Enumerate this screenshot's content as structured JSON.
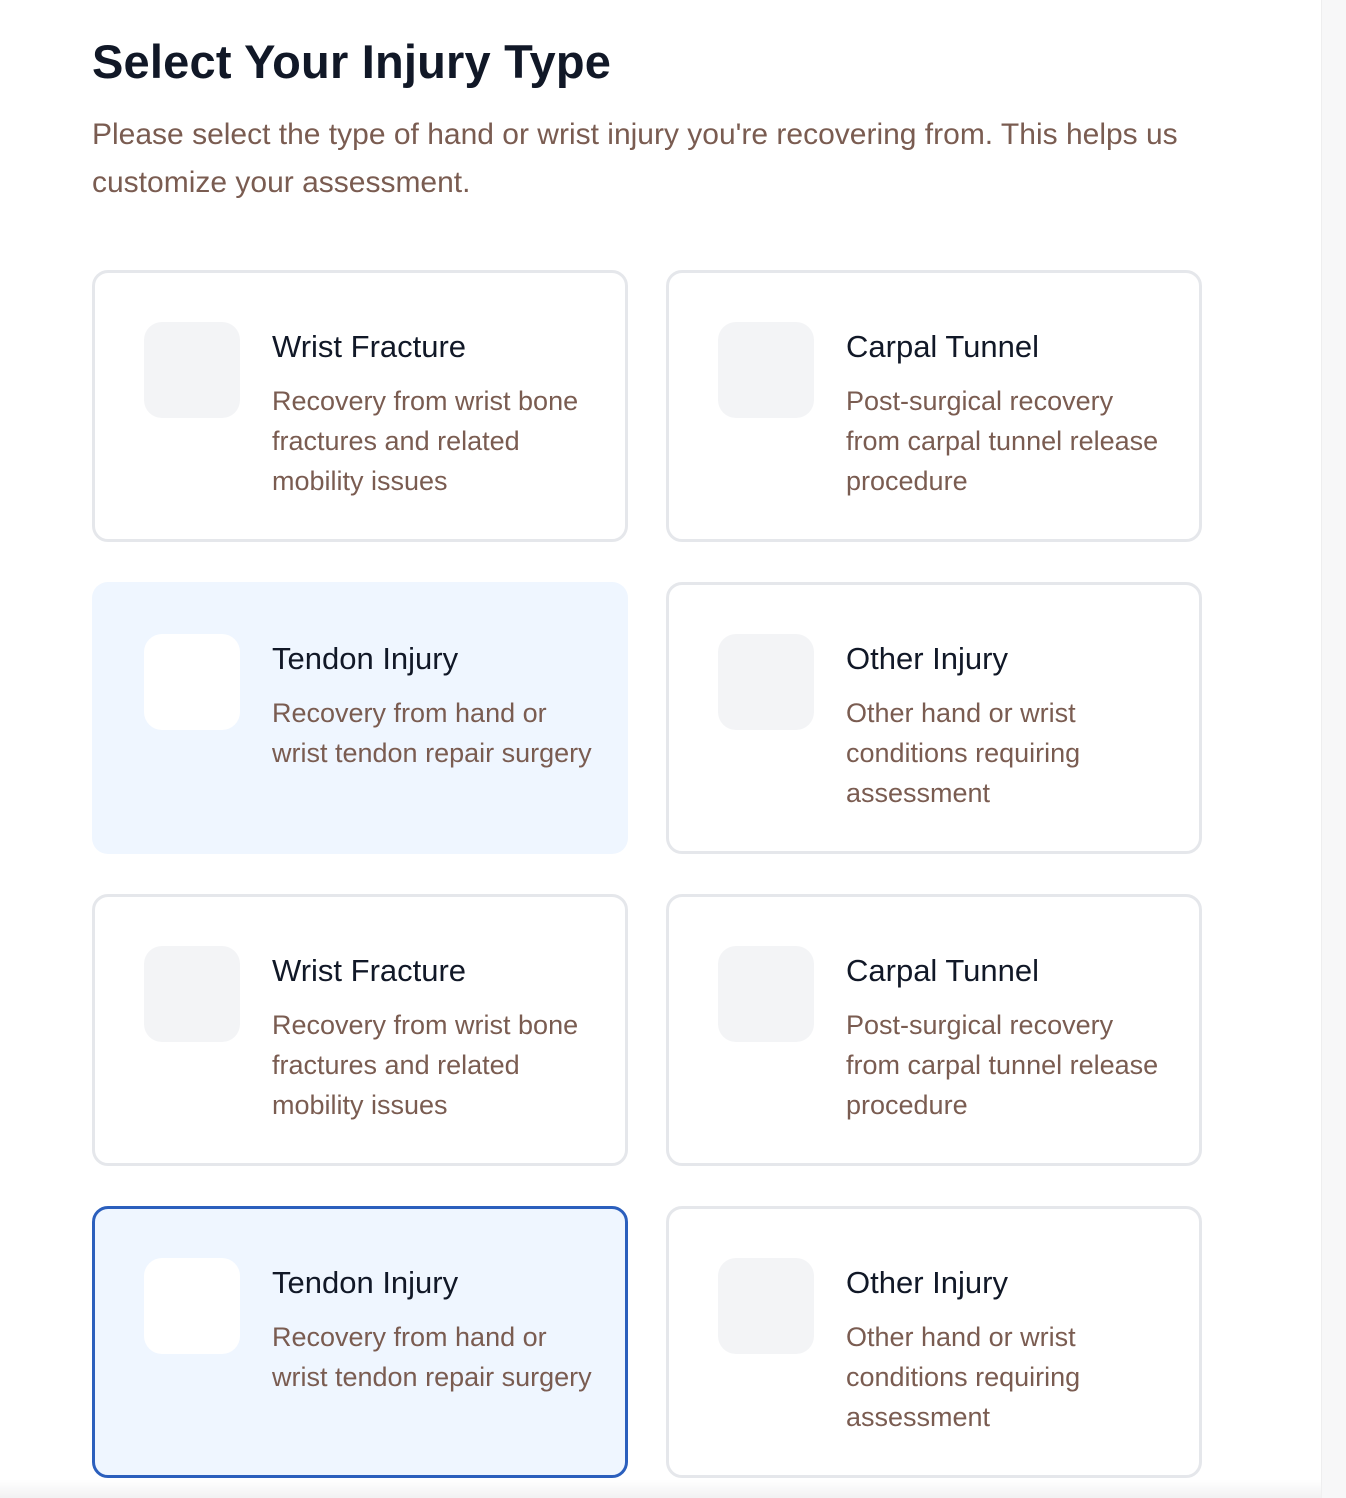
{
  "header": {
    "title": "Select Your Injury Type",
    "subtitle": "Please select the type of hand or wrist injury you're recovering from. This helps us customize your assessment."
  },
  "injury_options": [
    {
      "title": "Wrist Fracture",
      "description": "Recovery from wrist bone fractures and related mobility issues",
      "state": "default"
    },
    {
      "title": "Carpal Tunnel",
      "description": "Post-surgical recovery from carpal tunnel release procedure",
      "state": "default"
    },
    {
      "title": "Tendon Injury",
      "description": "Recovery from hand or wrist tendon repair surgery",
      "state": "hovered"
    },
    {
      "title": "Other Injury",
      "description": "Other hand or wrist conditions requiring assessment",
      "state": "default"
    },
    {
      "title": "Wrist Fracture",
      "description": "Recovery from wrist bone fractures and related mobility issues",
      "state": "default"
    },
    {
      "title": "Carpal Tunnel",
      "description": "Post-surgical recovery from carpal tunnel release procedure",
      "state": "default"
    },
    {
      "title": "Tendon Injury",
      "description": "Recovery from hand or wrist tendon repair surgery",
      "state": "selected"
    },
    {
      "title": "Other Injury",
      "description": "Other hand or wrist conditions requiring assessment",
      "state": "default"
    }
  ],
  "colors": {
    "accent_selected_border": "#2b5fbd",
    "highlight_background": "#eff6ff",
    "title_text": "#111827",
    "secondary_text": "#7a5c51"
  }
}
